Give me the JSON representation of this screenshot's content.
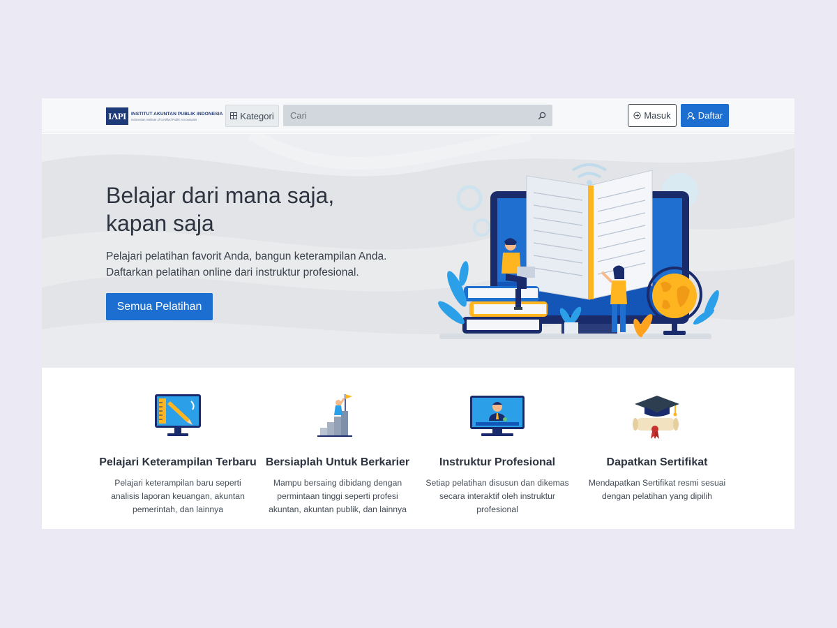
{
  "brand": {
    "mark": "IAPI",
    "title": "INSTITUT AKUNTAN PUBLIK INDONESIA",
    "subtitle": "Indonesian Institute of Certified Public Accountants"
  },
  "nav": {
    "kategori_label": "Kategori",
    "search_placeholder": "Cari",
    "login_label": "Masuk",
    "register_label": "Daftar"
  },
  "hero": {
    "title_line1": "Belajar dari mana saja,",
    "title_line2": "kapan saja",
    "desc_line1": "Pelajari pelatihan favorit Anda, bangun keterampilan Anda.",
    "desc_line2": "Daftarkan pelatihan online dari instruktur profesional.",
    "cta_label": "Semua Pelatihan"
  },
  "features": [
    {
      "icon": "monitor-pencil-icon",
      "title": "Pelajari Keterampilan Terbaru",
      "desc": "Pelajari keterampilan baru seperti analisis laporan keuangan, akuntan pemerintah, dan lainnya"
    },
    {
      "icon": "career-flag-icon",
      "title": "Bersiaplah Untuk Berkarier",
      "desc": "Mampu bersaing dibidang dengan permintaan tinggi seperti profesi akuntan, akuntan publik, dan lainnya"
    },
    {
      "icon": "instructor-screen-icon",
      "title": "Instruktur Profesional",
      "desc": "Setiap pelatihan disusun dan dikemas secara interaktif oleh instruktur profesional"
    },
    {
      "icon": "graduation-certificate-icon",
      "title": "Dapatkan Sertifikat",
      "desc": "Mendapatkan Sertifikat resmi sesuai dengan pelatihan yang dipilih"
    }
  ],
  "colors": {
    "primary": "#1c6fd1",
    "background": "#eae9f4",
    "navbar": "#f7f8fa",
    "hero": "#e3e4e7",
    "brand": "#1f3a78"
  }
}
